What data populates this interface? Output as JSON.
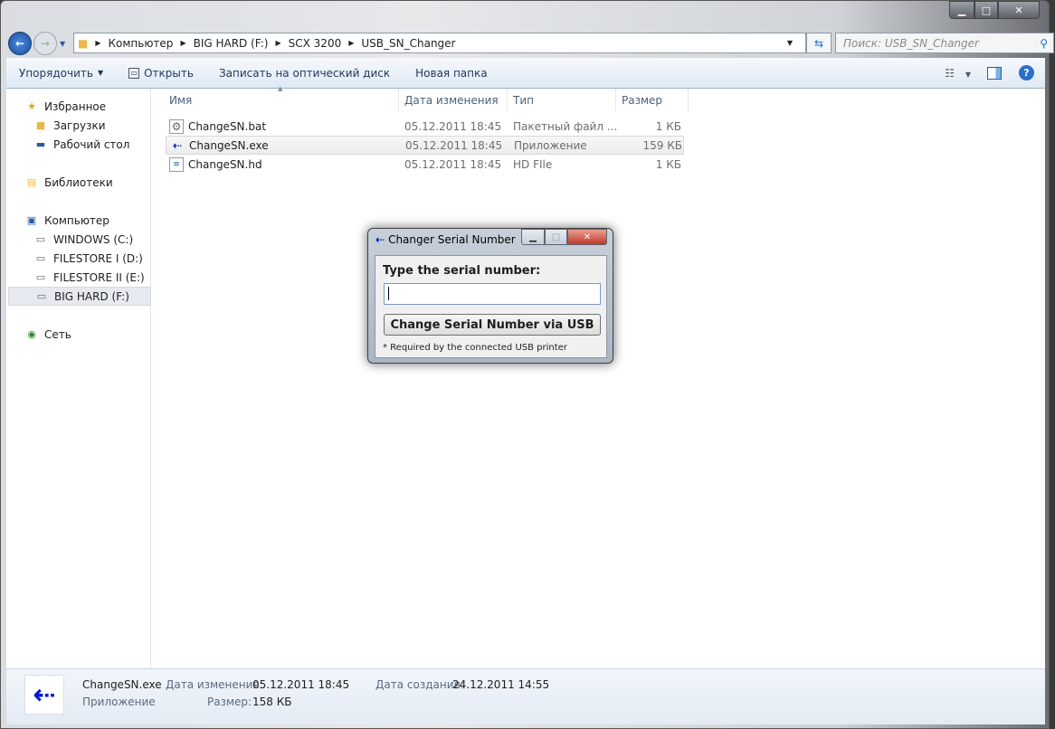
{
  "window": {
    "minimize": "▁",
    "maximize": "□",
    "close": "✕"
  },
  "address": {
    "crumbs": [
      "Компьютер",
      "BIG HARD (F:)",
      "SCX 3200",
      "USB_SN_Changer"
    ],
    "search_placeholder": "Поиск: USB_SN_Changer"
  },
  "toolbar": {
    "organize": "Упорядочить",
    "open": "Открыть",
    "burn": "Записать на оптический диск",
    "new_folder": "Новая папка"
  },
  "sidebar": {
    "items": [
      {
        "label": "Избранное",
        "icon": "star-icon"
      },
      {
        "label": "Загрузки",
        "icon": "downloads-folder-icon"
      },
      {
        "label": "Рабочий стол",
        "icon": "desktop-icon"
      },
      {
        "label": "Библиотеки",
        "icon": "libraries-icon"
      },
      {
        "label": "Компьютер",
        "icon": "computer-icon"
      },
      {
        "label": "WINDOWS (C:)",
        "icon": "drive-icon"
      },
      {
        "label": "FILESTORE I (D:)",
        "icon": "drive-icon"
      },
      {
        "label": "FILESTORE II (E:)",
        "icon": "drive-icon"
      },
      {
        "label": "BIG HARD (F:)",
        "icon": "drive-icon"
      },
      {
        "label": "Сеть",
        "icon": "network-icon"
      }
    ]
  },
  "columns": {
    "name": "Имя",
    "date": "Дата изменения",
    "type": "Тип",
    "size": "Размер"
  },
  "files": [
    {
      "name": "ChangeSN.bat",
      "date": "05.12.2011 18:45",
      "type": "Пакетный файл ...",
      "size": "1 КБ"
    },
    {
      "name": "ChangeSN.exe",
      "date": "05.12.2011 18:45",
      "type": "Приложение",
      "size": "159 КБ"
    },
    {
      "name": "ChangeSN.hd",
      "date": "05.12.2011 18:45",
      "type": "HD FIle",
      "size": "1 КБ"
    }
  ],
  "details": {
    "name": "ChangeSN.exe",
    "type": "Приложение",
    "modified_label": "Дата изменения:",
    "modified": "05.12.2011 18:45",
    "size_label": "Размер:",
    "size": "158 КБ",
    "created_label": "Дата создания:",
    "created": "24.12.2011 14:55"
  },
  "dialog": {
    "title": "Changer Serial Number",
    "prompt": "Type the serial number:",
    "serial_value": "",
    "button": "Change Serial Number via USB",
    "note": "* Required by the connected USB printer"
  }
}
